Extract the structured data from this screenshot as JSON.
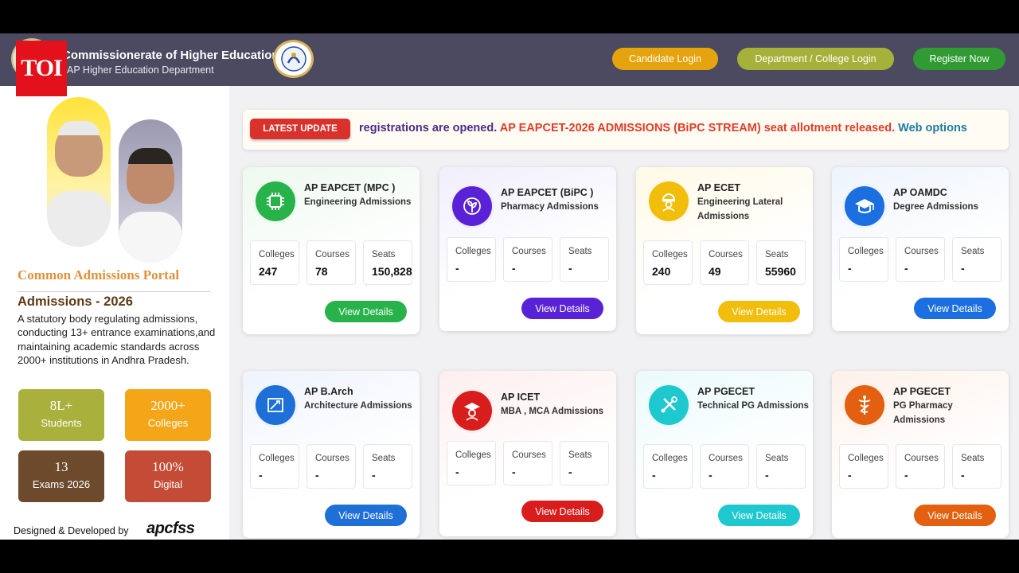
{
  "header": {
    "title": "Commissionerate of Higher Education",
    "subtitle": "AP Higher Education Department",
    "buttons": {
      "candidate": "Candidate Login",
      "department": "Department / College Login",
      "register": "Register Now"
    }
  },
  "watermark": "TOI",
  "sidebar": {
    "portal_title": "Common Admissions Portal",
    "admissions_year": "Admissions - 2026",
    "description": "A statutory body regulating admissions, conducting 13+ entrance examinations,and maintaining academic standards across 2000+ institutions in Andhra Pradesh.",
    "stats": [
      {
        "num": "8L+",
        "label": "Students",
        "color": "#a9b03c"
      },
      {
        "num": "2000+",
        "label": "Colleges",
        "color": "#f4a618"
      },
      {
        "num": "13",
        "label": "Exams 2026",
        "color": "#6d4a2c"
      },
      {
        "num": "100%",
        "label": "Digital",
        "color": "#c44b36"
      }
    ],
    "footer_label": "Designed & Developed by",
    "footer_brand": "apcfss"
  },
  "ticker": {
    "badge": "LATEST UPDATE",
    "text_a": "registrations are opened.",
    "text_b": "AP EAPCET-2026 ADMISSIONS (BiPC STREAM) seat allotment released.",
    "text_c": "Web options"
  },
  "labels": {
    "colleges": "Colleges",
    "courses": "Courses",
    "seats": "Seats",
    "view": "View Details"
  },
  "cards": [
    {
      "title": "AP EAPCET (MPC )",
      "subtitle": "Engineering Admissions",
      "colleges": "247",
      "courses": "78",
      "seats": "150,828",
      "color": "#27b34a",
      "bg": "#edf9ee",
      "icon": "chip-icon"
    },
    {
      "title": "AP EAPCET (BiPC )",
      "subtitle": "Pharmacy Admissions",
      "colleges": "-",
      "courses": "-",
      "seats": "-",
      "color": "#5a22d6",
      "bg": "#f1eefc",
      "icon": "plant-icon"
    },
    {
      "title": "AP ECET",
      "subtitle": "Engineering Lateral Admissions",
      "colleges": "240",
      "courses": "49",
      "seats": "55960",
      "color": "#f2be0c",
      "bg": "#fff9e6",
      "icon": "engineer-icon"
    },
    {
      "title": "AP OAMDC",
      "subtitle": "Degree Admissions",
      "colleges": "-",
      "courses": "-",
      "seats": "-",
      "color": "#1c6fe0",
      "bg": "#eef4fd",
      "icon": "graduation-cap-icon"
    },
    {
      "title": "AP B.Arch",
      "subtitle": "Architecture Admissions",
      "colleges": "-",
      "courses": "-",
      "seats": "-",
      "color": "#1e6fd6",
      "bg": "#eef4fd",
      "icon": "blueprint-icon"
    },
    {
      "title": "AP ICET",
      "subtitle": "MBA , MCA Admissions",
      "colleges": "-",
      "courses": "-",
      "seats": "-",
      "color": "#d81d1d",
      "bg": "#fdeeee",
      "icon": "graduate-icon"
    },
    {
      "title": "AP PGECET",
      "subtitle": "Technical PG Admissions",
      "colleges": "-",
      "courses": "-",
      "seats": "-",
      "color": "#1dc8cf",
      "bg": "#ebfafb",
      "icon": "tools-icon"
    },
    {
      "title": "AP PGECET",
      "subtitle": "PG Pharmacy Admissions",
      "colleges": "-",
      "courses": "-",
      "seats": "-",
      "color": "#e2600f",
      "bg": "#fdf1e9",
      "icon": "caduceus-icon"
    }
  ]
}
